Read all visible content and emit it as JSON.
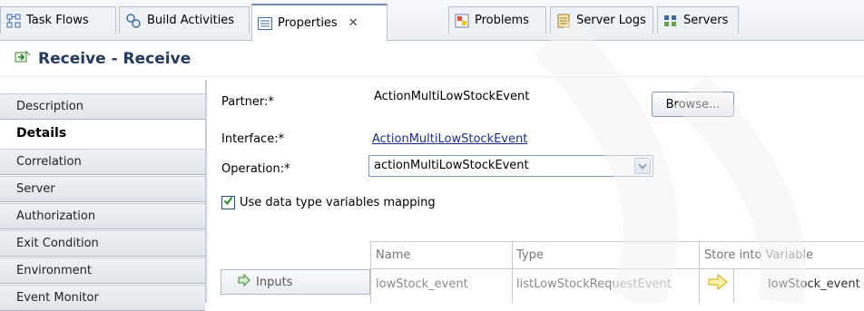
{
  "tabs": [
    {
      "label": "Task Flows",
      "icon": "task-flows-icon",
      "active": false
    },
    {
      "label": "Build Activities",
      "icon": "build-activities-icon",
      "active": false
    },
    {
      "label": "Properties",
      "icon": "properties-icon",
      "active": true,
      "close": "✕"
    },
    {
      "label": "Problems",
      "icon": "problems-icon",
      "active": false
    },
    {
      "label": "Server Logs",
      "icon": "server-logs-icon",
      "active": false
    },
    {
      "label": "Servers",
      "icon": "servers-icon",
      "active": false
    }
  ],
  "title": "Receive - Receive",
  "sidebar": {
    "items": [
      {
        "label": "Description",
        "active": false
      },
      {
        "label": "Details",
        "active": true
      },
      {
        "label": "Correlation",
        "active": false
      },
      {
        "label": "Server",
        "active": false
      },
      {
        "label": "Authorization",
        "active": false
      },
      {
        "label": "Exit Condition",
        "active": false
      },
      {
        "label": "Environment",
        "active": false
      },
      {
        "label": "Event Monitor",
        "active": false
      }
    ]
  },
  "form": {
    "partner_label": "Partner:*",
    "partner_value": "ActionMultiLowStockEvent",
    "browse_label": "Browse...",
    "interface_label": "Interface:*",
    "interface_value": "ActionMultiLowStockEvent",
    "operation_label": "Operation:*",
    "operation_value": "actionMultiLowStockEvent",
    "mapping_checkbox_label": "Use data type variables mapping",
    "mapping_checked": true
  },
  "table": {
    "headers": [
      "Name",
      "Type",
      "Store into Variable"
    ],
    "rows": [
      {
        "section": "Inputs",
        "name": "lowStock_event",
        "type": "listLowStockRequestEvent",
        "variable": "lowStock_event"
      }
    ]
  },
  "colors": {
    "link": "#1b2f8a",
    "tab_border": "#b9c2cf",
    "title_text": "#243a5e",
    "checkbox_check": "#2a8a2a",
    "arrow_yellow": "#f2c100"
  }
}
